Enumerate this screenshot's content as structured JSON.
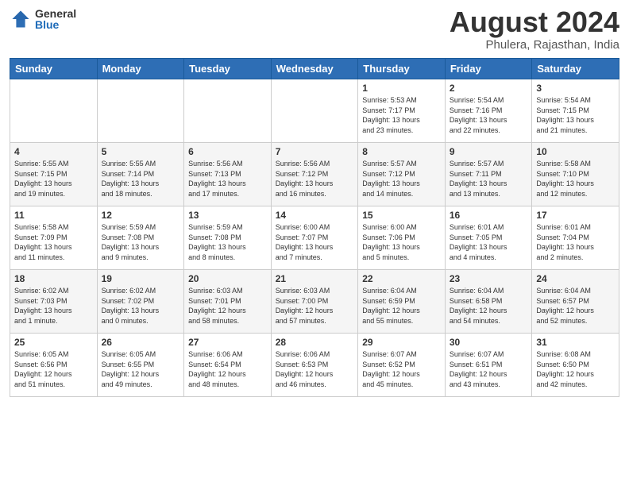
{
  "logo": {
    "general": "General",
    "blue": "Blue"
  },
  "title": "August 2024",
  "location": "Phulera, Rajasthan, India",
  "days_of_week": [
    "Sunday",
    "Monday",
    "Tuesday",
    "Wednesday",
    "Thursday",
    "Friday",
    "Saturday"
  ],
  "weeks": [
    [
      {
        "day": "",
        "info": ""
      },
      {
        "day": "",
        "info": ""
      },
      {
        "day": "",
        "info": ""
      },
      {
        "day": "",
        "info": ""
      },
      {
        "day": "1",
        "info": "Sunrise: 5:53 AM\nSunset: 7:17 PM\nDaylight: 13 hours\nand 23 minutes."
      },
      {
        "day": "2",
        "info": "Sunrise: 5:54 AM\nSunset: 7:16 PM\nDaylight: 13 hours\nand 22 minutes."
      },
      {
        "day": "3",
        "info": "Sunrise: 5:54 AM\nSunset: 7:15 PM\nDaylight: 13 hours\nand 21 minutes."
      }
    ],
    [
      {
        "day": "4",
        "info": "Sunrise: 5:55 AM\nSunset: 7:15 PM\nDaylight: 13 hours\nand 19 minutes."
      },
      {
        "day": "5",
        "info": "Sunrise: 5:55 AM\nSunset: 7:14 PM\nDaylight: 13 hours\nand 18 minutes."
      },
      {
        "day": "6",
        "info": "Sunrise: 5:56 AM\nSunset: 7:13 PM\nDaylight: 13 hours\nand 17 minutes."
      },
      {
        "day": "7",
        "info": "Sunrise: 5:56 AM\nSunset: 7:12 PM\nDaylight: 13 hours\nand 16 minutes."
      },
      {
        "day": "8",
        "info": "Sunrise: 5:57 AM\nSunset: 7:12 PM\nDaylight: 13 hours\nand 14 minutes."
      },
      {
        "day": "9",
        "info": "Sunrise: 5:57 AM\nSunset: 7:11 PM\nDaylight: 13 hours\nand 13 minutes."
      },
      {
        "day": "10",
        "info": "Sunrise: 5:58 AM\nSunset: 7:10 PM\nDaylight: 13 hours\nand 12 minutes."
      }
    ],
    [
      {
        "day": "11",
        "info": "Sunrise: 5:58 AM\nSunset: 7:09 PM\nDaylight: 13 hours\nand 11 minutes."
      },
      {
        "day": "12",
        "info": "Sunrise: 5:59 AM\nSunset: 7:08 PM\nDaylight: 13 hours\nand 9 minutes."
      },
      {
        "day": "13",
        "info": "Sunrise: 5:59 AM\nSunset: 7:08 PM\nDaylight: 13 hours\nand 8 minutes."
      },
      {
        "day": "14",
        "info": "Sunrise: 6:00 AM\nSunset: 7:07 PM\nDaylight: 13 hours\nand 7 minutes."
      },
      {
        "day": "15",
        "info": "Sunrise: 6:00 AM\nSunset: 7:06 PM\nDaylight: 13 hours\nand 5 minutes."
      },
      {
        "day": "16",
        "info": "Sunrise: 6:01 AM\nSunset: 7:05 PM\nDaylight: 13 hours\nand 4 minutes."
      },
      {
        "day": "17",
        "info": "Sunrise: 6:01 AM\nSunset: 7:04 PM\nDaylight: 13 hours\nand 2 minutes."
      }
    ],
    [
      {
        "day": "18",
        "info": "Sunrise: 6:02 AM\nSunset: 7:03 PM\nDaylight: 13 hours\nand 1 minute."
      },
      {
        "day": "19",
        "info": "Sunrise: 6:02 AM\nSunset: 7:02 PM\nDaylight: 13 hours\nand 0 minutes."
      },
      {
        "day": "20",
        "info": "Sunrise: 6:03 AM\nSunset: 7:01 PM\nDaylight: 12 hours\nand 58 minutes."
      },
      {
        "day": "21",
        "info": "Sunrise: 6:03 AM\nSunset: 7:00 PM\nDaylight: 12 hours\nand 57 minutes."
      },
      {
        "day": "22",
        "info": "Sunrise: 6:04 AM\nSunset: 6:59 PM\nDaylight: 12 hours\nand 55 minutes."
      },
      {
        "day": "23",
        "info": "Sunrise: 6:04 AM\nSunset: 6:58 PM\nDaylight: 12 hours\nand 54 minutes."
      },
      {
        "day": "24",
        "info": "Sunrise: 6:04 AM\nSunset: 6:57 PM\nDaylight: 12 hours\nand 52 minutes."
      }
    ],
    [
      {
        "day": "25",
        "info": "Sunrise: 6:05 AM\nSunset: 6:56 PM\nDaylight: 12 hours\nand 51 minutes."
      },
      {
        "day": "26",
        "info": "Sunrise: 6:05 AM\nSunset: 6:55 PM\nDaylight: 12 hours\nand 49 minutes."
      },
      {
        "day": "27",
        "info": "Sunrise: 6:06 AM\nSunset: 6:54 PM\nDaylight: 12 hours\nand 48 minutes."
      },
      {
        "day": "28",
        "info": "Sunrise: 6:06 AM\nSunset: 6:53 PM\nDaylight: 12 hours\nand 46 minutes."
      },
      {
        "day": "29",
        "info": "Sunrise: 6:07 AM\nSunset: 6:52 PM\nDaylight: 12 hours\nand 45 minutes."
      },
      {
        "day": "30",
        "info": "Sunrise: 6:07 AM\nSunset: 6:51 PM\nDaylight: 12 hours\nand 43 minutes."
      },
      {
        "day": "31",
        "info": "Sunrise: 6:08 AM\nSunset: 6:50 PM\nDaylight: 12 hours\nand 42 minutes."
      }
    ]
  ]
}
